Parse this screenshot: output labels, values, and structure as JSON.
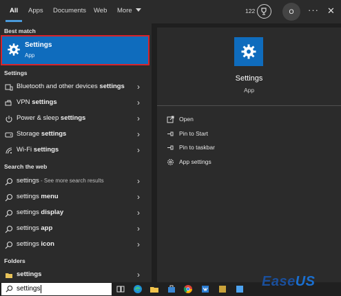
{
  "tabs": [
    {
      "label": "All",
      "active": true
    },
    {
      "label": "Apps"
    },
    {
      "label": "Documents"
    },
    {
      "label": "Web"
    },
    {
      "label": "More"
    }
  ],
  "header": {
    "points": "122",
    "avatar_initial": "O",
    "more_options": "···",
    "close": "✕"
  },
  "sections": {
    "best_match": "Best match",
    "settings": "Settings",
    "search_web": "Search the web",
    "folders": "Folders"
  },
  "best_match": {
    "title": "Settings",
    "subtitle": "App",
    "icon": "gear-icon",
    "accent": "#0f6cbd",
    "highlight": "#d8232a"
  },
  "settings_results": [
    {
      "prefix": "Bluetooth and other devices ",
      "bold": "settings",
      "icon": "bluetooth-devices-icon"
    },
    {
      "prefix": "VPN ",
      "bold": "settings",
      "icon": "vpn-icon"
    },
    {
      "prefix": "Power & sleep ",
      "bold": "settings",
      "icon": "power-icon"
    },
    {
      "prefix": "Storage ",
      "bold": "settings",
      "icon": "storage-icon"
    },
    {
      "prefix": "Wi-Fi ",
      "bold": "settings",
      "icon": "wifi-icon"
    }
  ],
  "web_results": [
    {
      "prefix": "settings",
      "bold": "",
      "suffix": " - See more search results",
      "icon": "search-icon"
    },
    {
      "prefix": "settings ",
      "bold": "menu",
      "suffix": "",
      "icon": "search-icon"
    },
    {
      "prefix": "settings ",
      "bold": "display",
      "suffix": "",
      "icon": "search-icon"
    },
    {
      "prefix": "settings ",
      "bold": "app",
      "suffix": "",
      "icon": "search-icon"
    },
    {
      "prefix": "settings ",
      "bold": "icon",
      "suffix": "",
      "icon": "search-icon"
    }
  ],
  "folder_results": [
    {
      "prefix": "",
      "bold": "settings",
      "icon": "folder-icon"
    }
  ],
  "detail": {
    "title": "Settings",
    "subtitle": "App",
    "actions": [
      {
        "label": "Open",
        "icon": "open-icon"
      },
      {
        "label": "Pin to Start",
        "icon": "pin-icon"
      },
      {
        "label": "Pin to taskbar",
        "icon": "pin-icon"
      },
      {
        "label": "App settings",
        "icon": "gear-icon"
      }
    ]
  },
  "taskbar": {
    "search_value": "settings"
  },
  "watermark": {
    "brand": "Ease",
    "brand_suffix": "US"
  }
}
